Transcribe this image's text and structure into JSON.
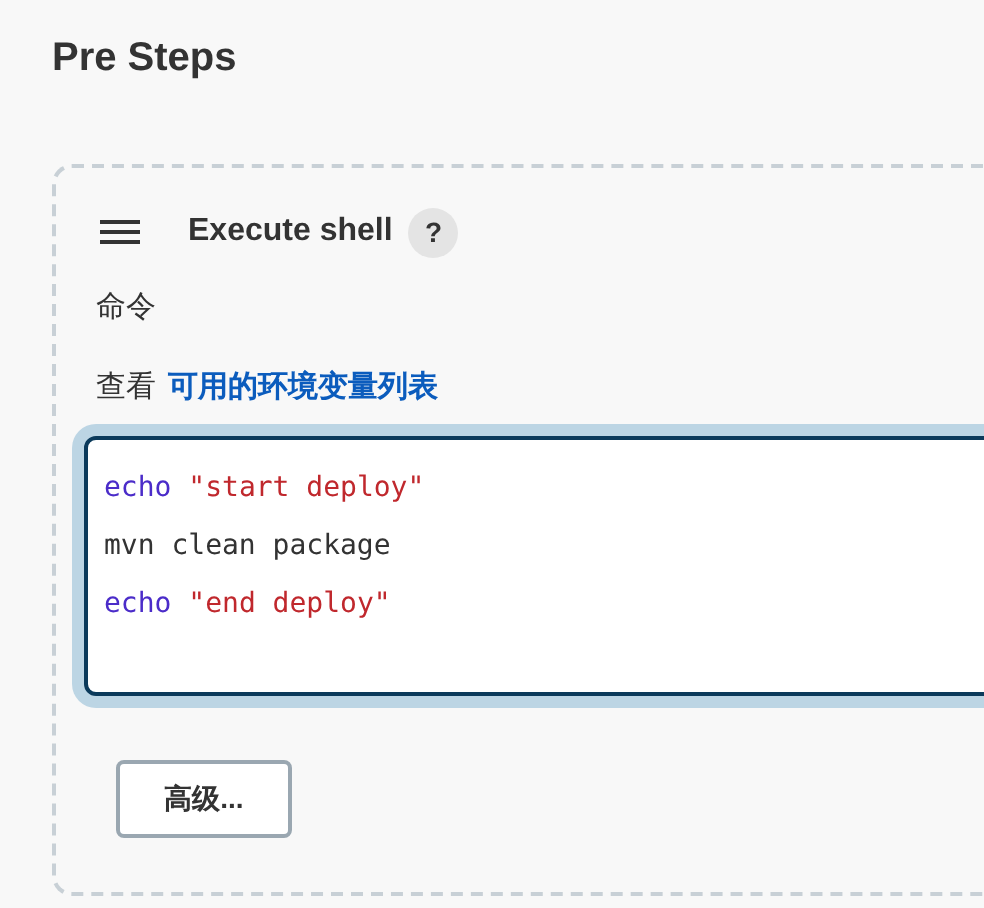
{
  "section_title": "Pre Steps",
  "step": {
    "title": "Execute shell",
    "help": "?",
    "command_label": "命令",
    "env_hint": {
      "prefix": "查看",
      "link": "可用的环境变量列表"
    },
    "script_lines": [
      {
        "tokens": [
          {
            "kind": "keyword",
            "text": "echo"
          },
          {
            "kind": "string",
            "text": "\"start deploy\""
          }
        ]
      },
      {
        "tokens": [
          {
            "kind": "plain",
            "text": "mvn clean package"
          }
        ]
      },
      {
        "tokens": [
          {
            "kind": "keyword",
            "text": "echo"
          },
          {
            "kind": "string",
            "text": "\"end deploy\""
          }
        ]
      }
    ],
    "focused": true,
    "advanced_button": "高级..."
  }
}
